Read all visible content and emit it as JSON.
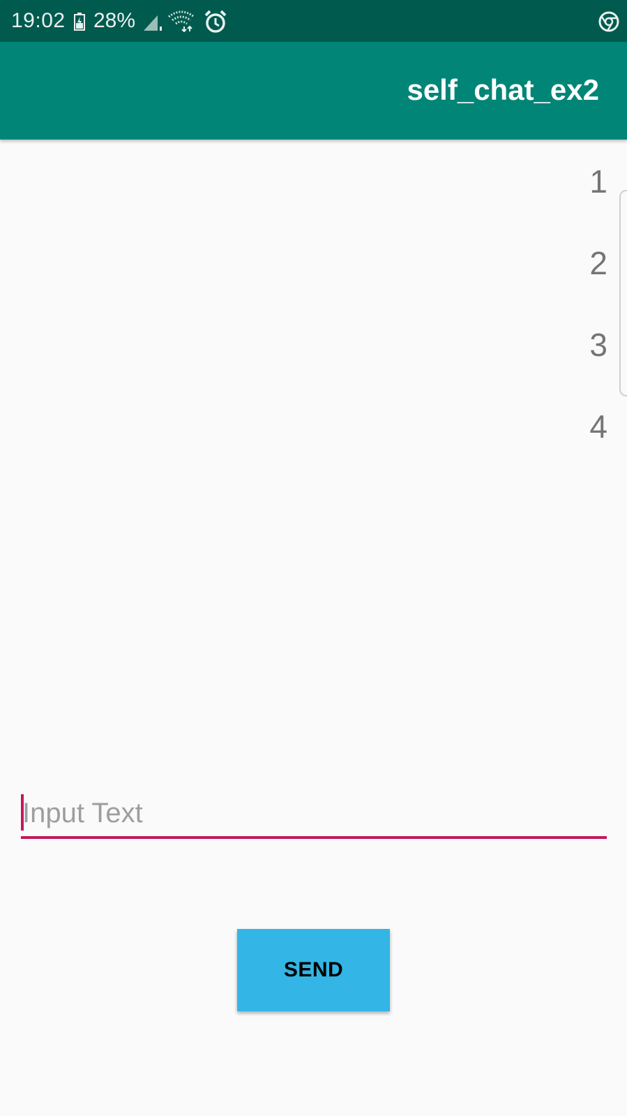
{
  "status_bar": {
    "time": "19:02",
    "battery_percent": "28%",
    "icons": [
      "battery-charging-icon",
      "cell-signal-icon",
      "wifi-icon",
      "alarm-icon",
      "chrome-icon"
    ]
  },
  "app_bar": {
    "title": "self_chat_ex2"
  },
  "list": {
    "items": [
      "1",
      "2",
      "3",
      "4"
    ]
  },
  "input": {
    "placeholder": "Input Text",
    "value": ""
  },
  "send_button": {
    "label": "SEND"
  },
  "colors": {
    "status_bar": "#005a4e",
    "app_bar": "#008577",
    "accent": "#c2185b",
    "button": "#33b5e5",
    "background": "#fafafa"
  }
}
